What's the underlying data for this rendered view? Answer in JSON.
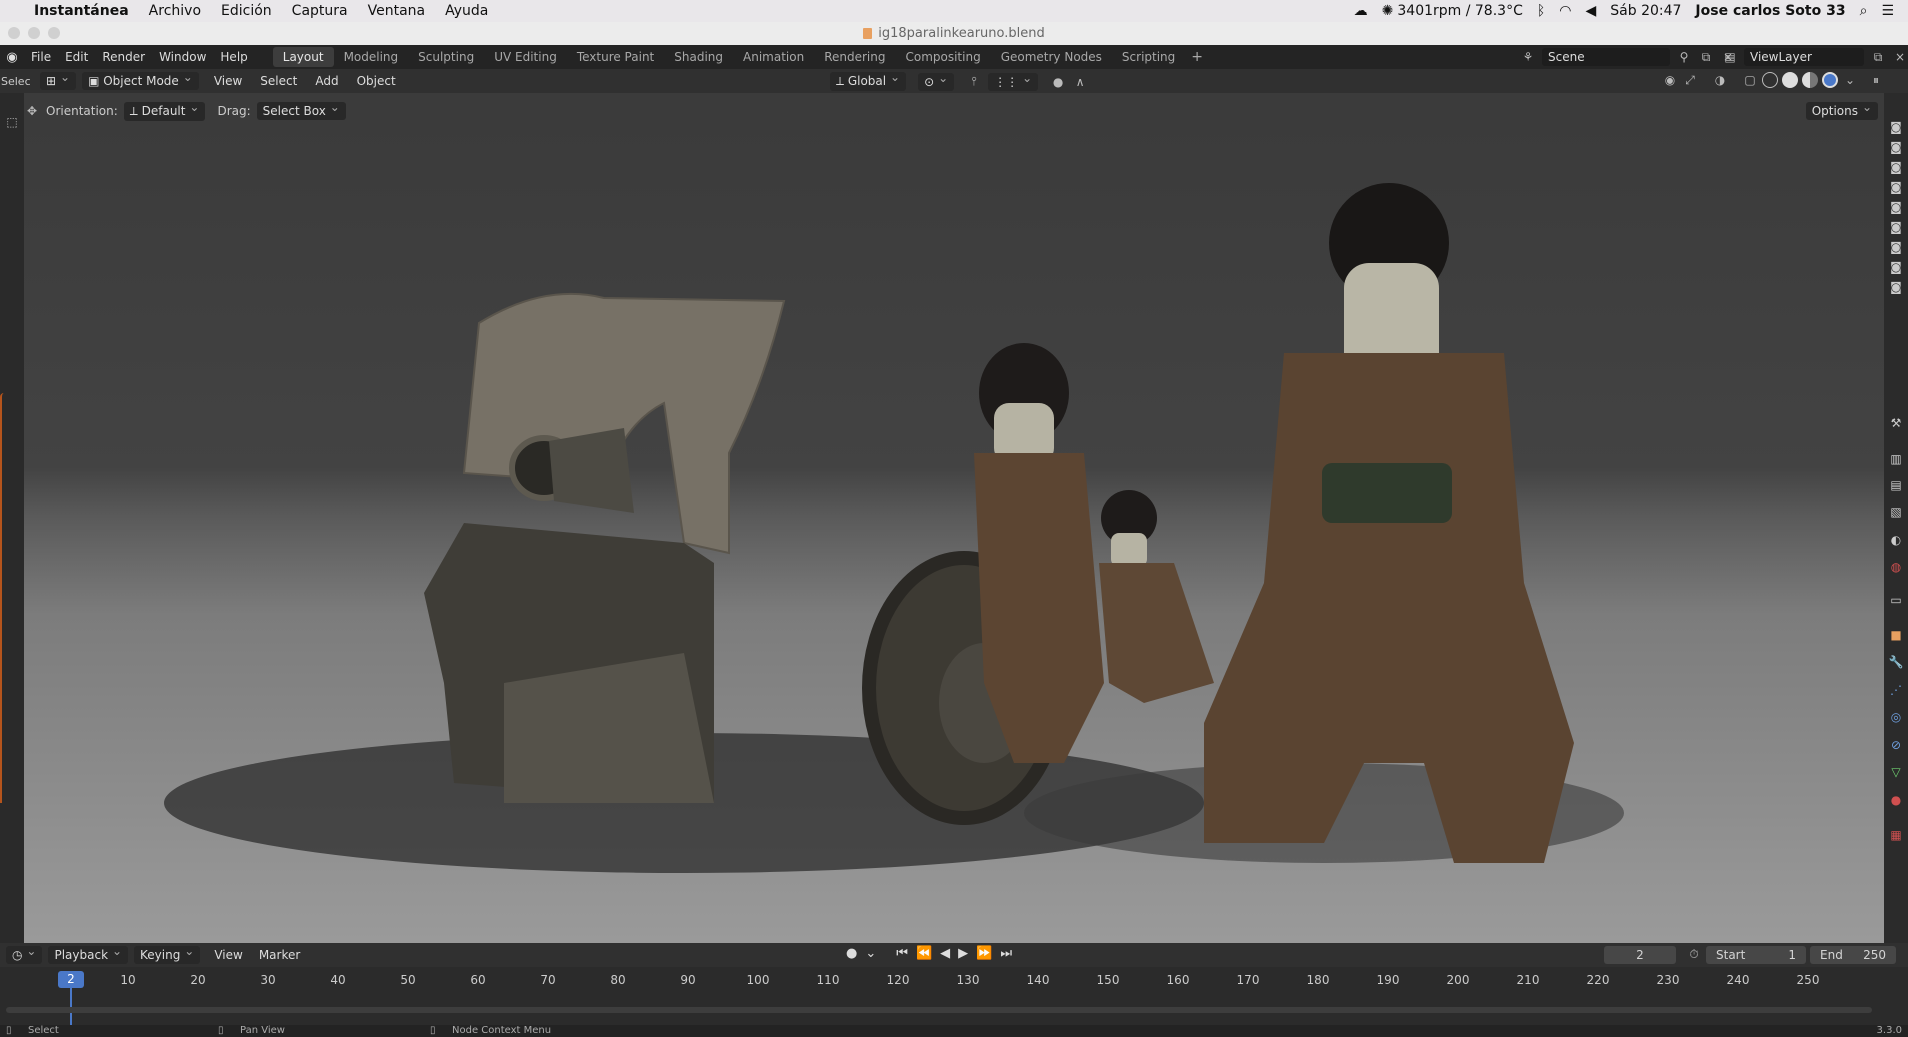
{
  "mac_menubar": {
    "apple_icon": "apple-icon",
    "app_name": "Instantánea",
    "menus": [
      "Archivo",
      "Edición",
      "Captura",
      "Ventana",
      "Ayuda"
    ],
    "sensor": "3401rpm / 78.3°C",
    "clock": "Sáb 20:47",
    "user": "Jose carlos Soto 33"
  },
  "window": {
    "title": "ig18paralinkearuno.blend"
  },
  "topbar": {
    "menus": [
      "File",
      "Edit",
      "Render",
      "Window",
      "Help"
    ],
    "workspaces": [
      "Layout",
      "Modeling",
      "Sculpting",
      "UV Editing",
      "Texture Paint",
      "Shading",
      "Animation",
      "Rendering",
      "Compositing",
      "Geometry Nodes",
      "Scripting"
    ],
    "active_workspace": "Layout",
    "add_workspace": "+",
    "scene": "Scene",
    "view_layer": "ViewLayer"
  },
  "header": {
    "left_label": "Selec",
    "mode": "Object Mode",
    "menus": [
      "View",
      "Select",
      "Add",
      "Object"
    ],
    "transform_orientation": "Global",
    "options": "Options"
  },
  "tool_settings": {
    "orientation_label": "Orientation:",
    "orientation_value": "Default",
    "drag_label": "Drag:",
    "drag_value": "Select Box"
  },
  "timeline": {
    "menus": [
      "Playback",
      "Keying",
      "View",
      "Marker"
    ],
    "current_frame": "2",
    "start_label": "Start",
    "start_value": "1",
    "end_label": "End",
    "end_value": "250",
    "ticks": [
      "10",
      "20",
      "30",
      "40",
      "50",
      "60",
      "70",
      "80",
      "90",
      "100",
      "110",
      "120",
      "130",
      "140",
      "150",
      "160",
      "170",
      "180",
      "190",
      "200",
      "210",
      "220",
      "230",
      "240",
      "250"
    ],
    "playhead": "2"
  },
  "statusbar": {
    "select": "Select",
    "pan": "Pan View",
    "context": "Node Context Menu",
    "version": "3.3.0"
  },
  "colors": {
    "accent": "#4a78c8",
    "active_orange": "#e8a060"
  }
}
